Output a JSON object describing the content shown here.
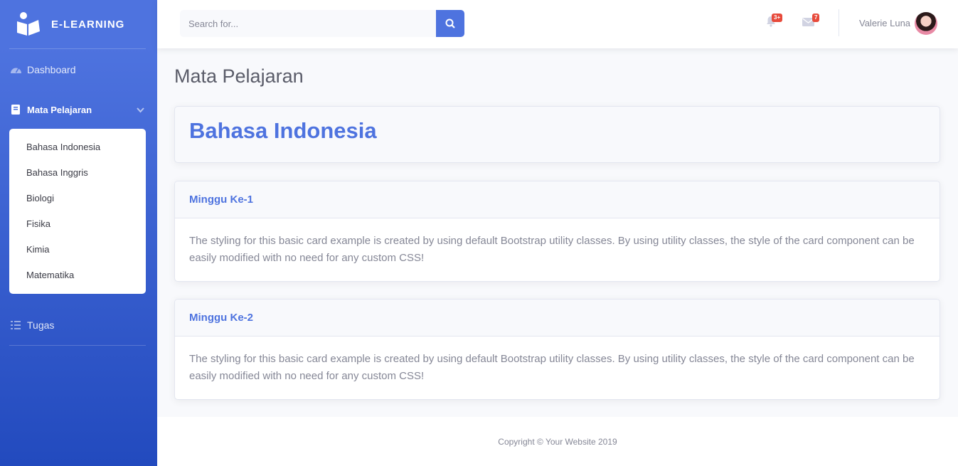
{
  "brand": {
    "name": "E-LEARNING"
  },
  "sidebar": {
    "items": [
      {
        "label": "Dashboard",
        "icon": "tachometer-icon"
      },
      {
        "label": "Mata Pelajaran",
        "icon": "book-icon"
      },
      {
        "label": "Tugas",
        "icon": "tasks-icon"
      }
    ],
    "submenu": [
      "Bahasa Indonesia",
      "Bahasa Inggris",
      "Biologi",
      "Fisika",
      "Kimia",
      "Matematika"
    ]
  },
  "topbar": {
    "search_placeholder": "Search for...",
    "alerts_badge": "3+",
    "messages_badge": "7",
    "user_name": "Valerie Luna"
  },
  "main": {
    "page_title": "Mata Pelajaran",
    "subject_title": "Bahasa Indonesia",
    "cards": [
      {
        "title": "Minggu Ke-1",
        "body": "The styling for this basic card example is created by using default Bootstrap utility classes. By using utility classes, the style of the card component can be easily modified with no need for any custom CSS!"
      },
      {
        "title": "Minggu Ke-2",
        "body": "The styling for this basic card example is created by using default Bootstrap utility classes. By using utility classes, the style of the card component can be easily modified with no need for any custom CSS!"
      }
    ]
  },
  "footer": {
    "copyright": "Copyright © Your Website 2019"
  },
  "colors": {
    "primary": "#4e73df",
    "danger": "#e74a3b",
    "text_muted": "#858796"
  }
}
